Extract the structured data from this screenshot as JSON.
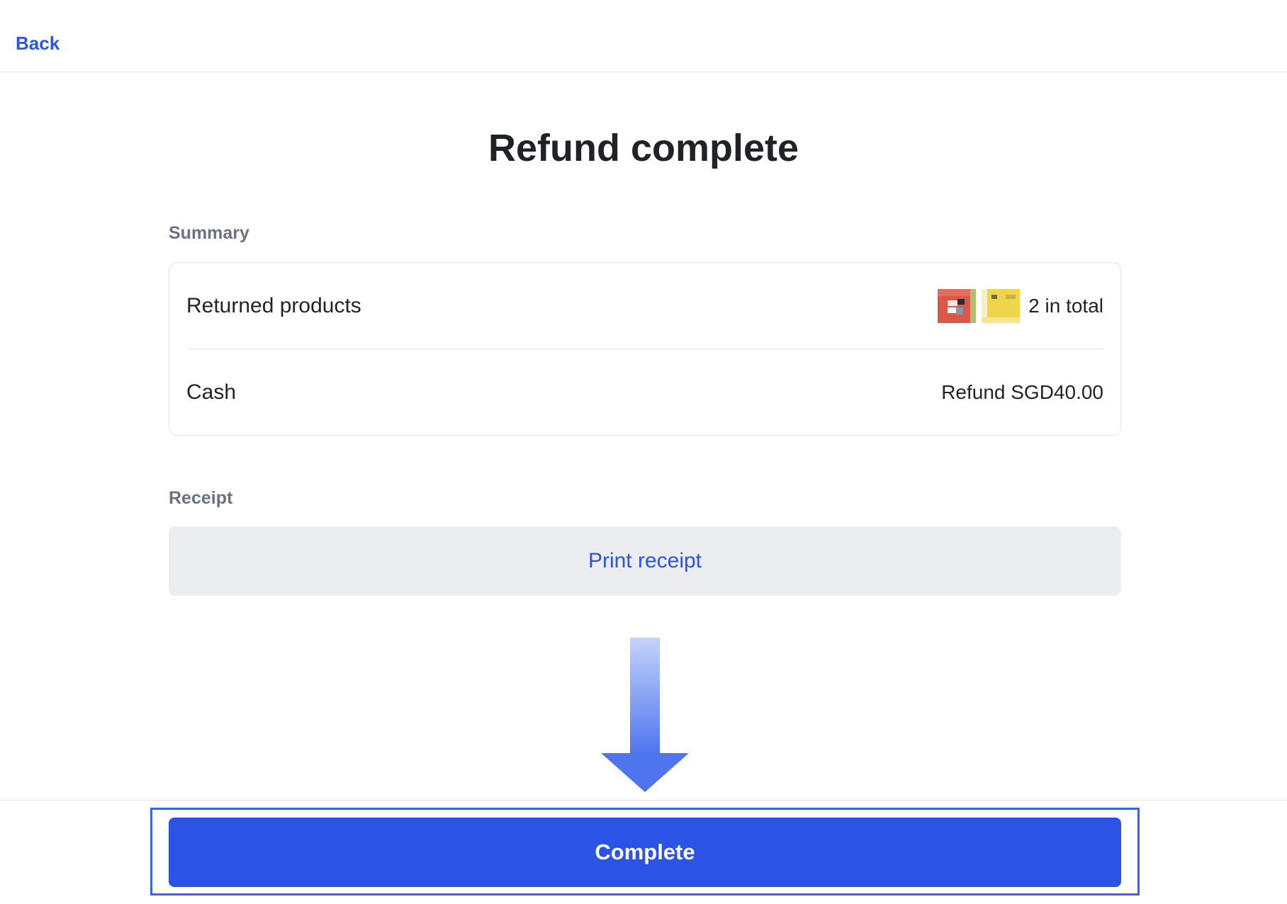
{
  "header": {
    "back_label": "Back"
  },
  "page": {
    "title": "Refund complete"
  },
  "summary": {
    "section_label": "Summary",
    "returned_products": {
      "label": "Returned products",
      "count_text": "2 in total"
    },
    "payment": {
      "label": "Cash",
      "amount_text": "Refund SGD40.00"
    }
  },
  "receipt": {
    "section_label": "Receipt",
    "print_label": "Print receipt"
  },
  "footer": {
    "complete_label": "Complete"
  },
  "colors": {
    "accent": "#2b53e6",
    "muted_text": "#6b7280",
    "button_secondary_bg": "#ebedf1"
  }
}
